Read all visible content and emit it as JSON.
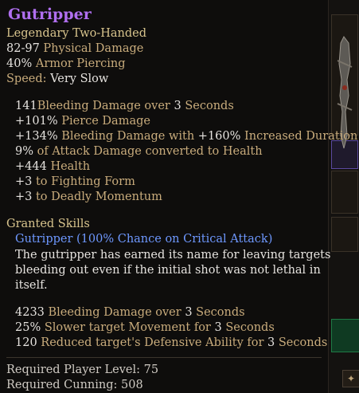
{
  "item": {
    "name": "Gutripper",
    "rarity_type": "Legendary Two-Handed",
    "base_stats": [
      {
        "value": "82-97",
        "label": "Physical Damage"
      },
      {
        "value": "40%",
        "label": "Armor Piercing"
      },
      {
        "label": "Speed:",
        "value": "Very Slow"
      }
    ],
    "bonuses": [
      {
        "value": "141",
        "label": "Bleeding Damage over ",
        "value2": "3",
        "label2": " Seconds"
      },
      {
        "value": "+101%",
        "label": "Pierce Damage"
      },
      {
        "value": "+134%",
        "label": "Bleeding Damage with ",
        "value2": "+160%",
        "label2": "Increased Duration"
      },
      {
        "value": "9%",
        "label": "of Attack Damage converted to Health"
      },
      {
        "value": "+444",
        "label": "Health"
      },
      {
        "value": "+3",
        "label": "to Fighting Form"
      },
      {
        "value": "+3",
        "label": "to Deadly Momentum"
      }
    ],
    "granted_skills": {
      "heading": "Granted Skills",
      "skill_name": "Gutripper (100% Chance on Critical Attack)",
      "description": [
        "The gutripper has earned its name for leaving targets",
        "bleeding out even if the initial shot was not lethal in",
        "itself."
      ],
      "effects": [
        {
          "value": "4233",
          "label": "Bleeding Damage over ",
          "value2": "3",
          "label2": " Seconds"
        },
        {
          "value": "25%",
          "label": "Slower target Movement for ",
          "value2": "3",
          "label2": " Seconds"
        },
        {
          "value": "120",
          "label": "Reduced target's Defensive Ability for ",
          "value2": "3",
          "label2": " Seconds"
        }
      ]
    },
    "requirements": [
      {
        "label": "Required Player Level:",
        "value": "75"
      },
      {
        "label": "Required Cunning:",
        "value": "508"
      }
    ]
  },
  "colors": {
    "name_purple": "#b06ff0",
    "stat_value_white": "#e6e3df",
    "stat_label_tan": "#c9ac7c",
    "skill_blue": "#6e98ff"
  },
  "icons": {
    "weapon": "crossbow-weapon-icon",
    "corner": "settings-icon"
  }
}
